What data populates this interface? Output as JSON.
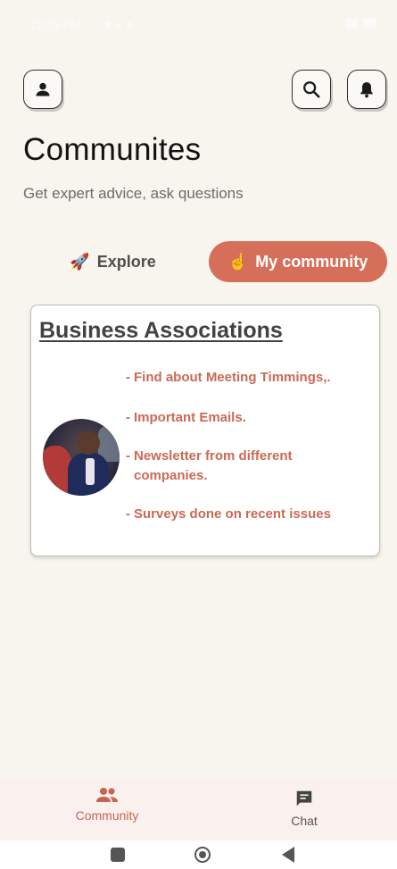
{
  "status_bar": {
    "time": "12:23 PM",
    "left_icons": [
      "wifi-icon",
      "signal-icon",
      "location-icon",
      "whatsapp-icon"
    ],
    "right_icons": [
      "sim-icon",
      "battery-icon"
    ]
  },
  "header": {
    "title": "Communites",
    "subtitle": "Get expert advice, ask questions"
  },
  "tabs": [
    {
      "emoji": "🚀",
      "label": "Explore",
      "active": false
    },
    {
      "emoji": "☝",
      "label": "My community",
      "active": true
    }
  ],
  "community_card": {
    "title": "Business Associations",
    "features": [
      {
        "dash": "-",
        "text": "Find about Meeting Timmings,."
      },
      {
        "dash": "-",
        "text": "Important Emails."
      },
      {
        "dash": "-",
        "text": "Newsletter from different companies."
      },
      {
        "dash": "-",
        "text": "Surveys done on recent issues"
      }
    ]
  },
  "bottom_nav": [
    {
      "label": "Community",
      "icon": "people-icon",
      "active": true
    },
    {
      "label": "Chat",
      "icon": "chat-icon",
      "active": false
    }
  ],
  "colors": {
    "background": "#f8f5ef",
    "accent": "#d56f5a",
    "feature_text": "#c96a55"
  }
}
